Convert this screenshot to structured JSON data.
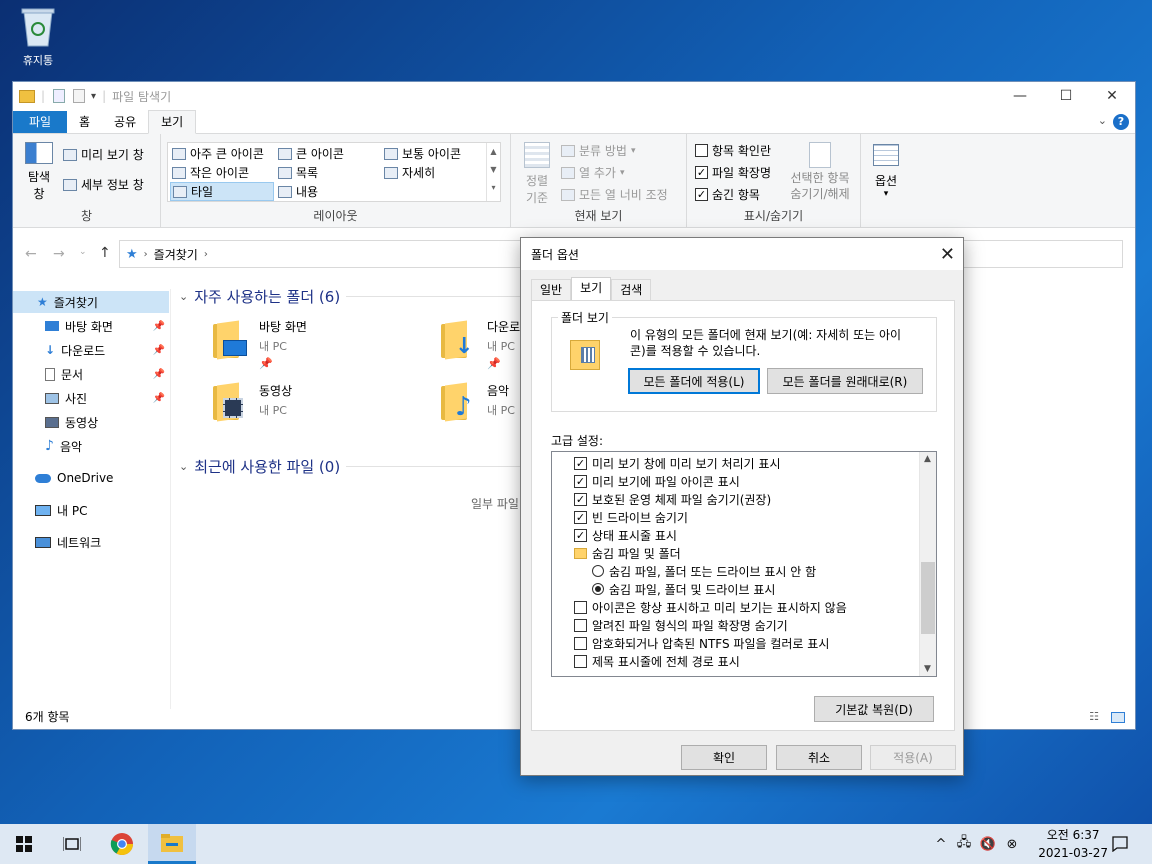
{
  "desktop": {
    "recycle_bin_label": "휴지통"
  },
  "explorer": {
    "title": "파일 탐색기",
    "controls": {
      "minimize": "—",
      "maximize": "☐",
      "close": "✕"
    },
    "tabs": [
      "파일",
      "홈",
      "공유",
      "보기"
    ],
    "active_tab": "보기",
    "help": "?",
    "ribbon": {
      "pane_group": {
        "nav_pane_label1": "탐색",
        "nav_pane_label2": "창",
        "preview_pane": "미리 보기 창",
        "details_pane": "세부 정보 창",
        "group_label": "창"
      },
      "layout_group": {
        "items": [
          "아주 큰 아이콘",
          "큰 아이콘",
          "보통 아이콘",
          "작은 아이콘",
          "목록",
          "자세히",
          "타일",
          "내용"
        ],
        "selected": "타일",
        "group_label": "레이아웃"
      },
      "current_view_group": {
        "sort_label1": "정렬",
        "sort_label2": "기준",
        "group_by": "분류 방법",
        "add_columns": "열 추가",
        "fit_columns": "모든 열 너비 조정",
        "group_label": "현재 보기"
      },
      "show_hide_group": {
        "item_checkboxes": {
          "label": "항목 확인란",
          "checked": false
        },
        "file_extensions": {
          "label": "파일 확장명",
          "checked": true
        },
        "hidden_items": {
          "label": "숨긴 항목",
          "checked": true
        },
        "hide_selected1": "선택한 항목",
        "hide_selected2": "숨기기/해제",
        "group_label": "표시/숨기기"
      },
      "options_label": "옵션"
    },
    "address": {
      "path": "즐겨찾기"
    },
    "nav": [
      {
        "label": "즐겨찾기",
        "selected": true,
        "pinned": false
      },
      {
        "label": "바탕 화면",
        "pinned": true
      },
      {
        "label": "다운로드",
        "pinned": true
      },
      {
        "label": "문서",
        "pinned": true
      },
      {
        "label": "사진",
        "pinned": true
      },
      {
        "label": "동영상",
        "pinned": false
      },
      {
        "label": "음악",
        "pinned": false
      },
      {
        "label": "OneDrive",
        "pinned": false
      },
      {
        "label": "내 PC",
        "pinned": false
      },
      {
        "label": "네트워크",
        "pinned": false
      }
    ],
    "frequent_header": "자주 사용하는 폴더 (6)",
    "recent_header": "최근에 사용한 파일 (0)",
    "folders": [
      {
        "name": "바탕 화면",
        "location": "내 PC"
      },
      {
        "name": "다운로",
        "location": "내 PC"
      },
      {
        "name": "동영상",
        "location": "내 PC"
      },
      {
        "name": "음악",
        "location": "내 PC"
      }
    ],
    "recent_empty_text": "일부 파일",
    "status": "6개 항목"
  },
  "dialog": {
    "title": "폴더 옵션",
    "tabs": [
      "일반",
      "보기",
      "검색"
    ],
    "active_tab": "보기",
    "folder_views_label": "폴더 보기",
    "folder_views_desc1": "이 유형의 모든 폴더에 현재 보기(예: 자세히 또는 아이",
    "folder_views_desc2": "콘)를 적용할 수 있습니다.",
    "apply_to_folders": "모든 폴더에 적용(L)",
    "reset_folders": "모든 폴더를 원래대로(R)",
    "advanced_label": "고급 설정:",
    "advanced_items": [
      {
        "type": "checkbox",
        "checked": true,
        "label": "미리 보기 창에 미리 보기 처리기 표시"
      },
      {
        "type": "checkbox",
        "checked": true,
        "label": "미리 보기에 파일 아이콘 표시"
      },
      {
        "type": "checkbox",
        "checked": true,
        "label": "보호된 운영 체제 파일 숨기기(권장)"
      },
      {
        "type": "checkbox",
        "checked": true,
        "label": "빈 드라이브 숨기기"
      },
      {
        "type": "checkbox",
        "checked": true,
        "label": "상태 표시줄 표시"
      },
      {
        "type": "folder",
        "label": "숨김 파일 및 폴더"
      },
      {
        "type": "radio",
        "checked": false,
        "label": "숨김 파일, 폴더 또는 드라이브 표시 안 함"
      },
      {
        "type": "radio",
        "checked": true,
        "label": "숨김 파일, 폴더 및 드라이브 표시"
      },
      {
        "type": "checkbox",
        "checked": false,
        "label": "아이콘은 항상 표시하고 미리 보기는 표시하지 않음"
      },
      {
        "type": "checkbox",
        "checked": false,
        "label": "알려진 파일 형식의 파일 확장명 숨기기"
      },
      {
        "type": "checkbox",
        "checked": false,
        "label": "암호화되거나 압축된 NTFS 파일을 컬러로 표시"
      },
      {
        "type": "checkbox",
        "checked": false,
        "label": "제목 표시줄에 전체 경로 표시"
      }
    ],
    "restore_defaults": "기본값 복원(D)",
    "ok": "확인",
    "cancel": "취소",
    "apply": "적용(A)"
  },
  "taskbar": {
    "clock_time": "오전 6:37",
    "clock_date": "2021-03-27",
    "tray_chevron": "^"
  },
  "colors": {
    "accent": "#1979ca",
    "selection": "#cce4f7",
    "folder": "#ffd36b"
  }
}
